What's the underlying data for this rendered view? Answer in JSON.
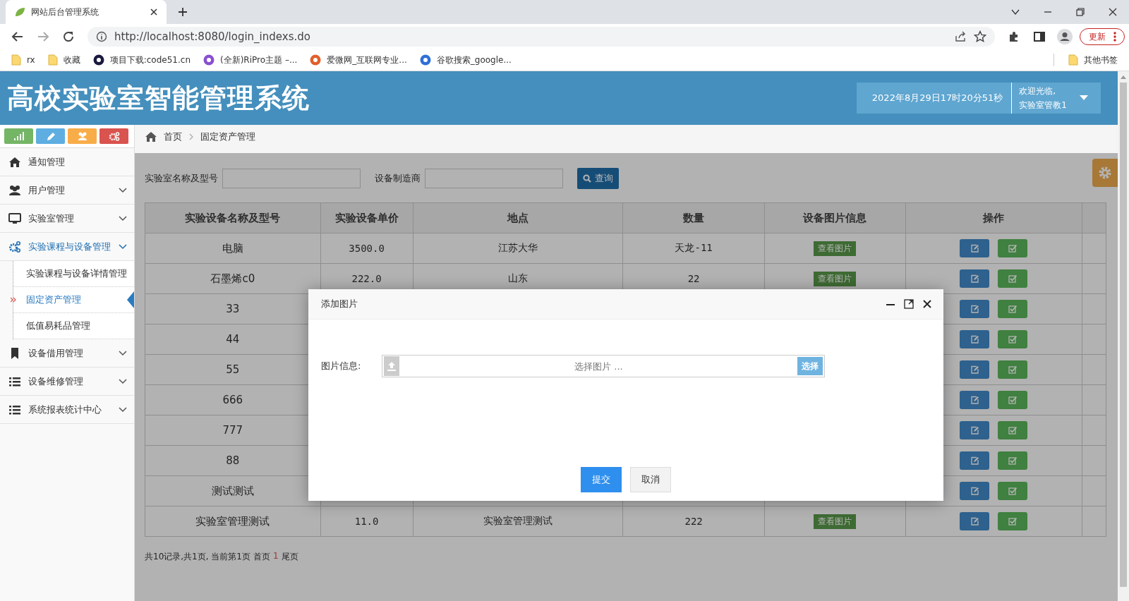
{
  "browser": {
    "tab_title": "网站后台管理系统",
    "url": "http://localhost:8080/login_indexs.do",
    "update_button": "更新",
    "other_bookmarks": "其他书签",
    "bookmarks": [
      {
        "label": "rx",
        "kind": "folder"
      },
      {
        "label": "收藏",
        "kind": "folder"
      },
      {
        "label": "项目下载:code51.cn",
        "kind": "site",
        "color": "#1a1a40"
      },
      {
        "label": "(全新)RiPro主题 –...",
        "kind": "site",
        "color": "#8a4fd0"
      },
      {
        "label": "爱微网_互联网专业...",
        "kind": "site",
        "color": "#e0602a"
      },
      {
        "label": "谷歌搜索_google...",
        "kind": "site",
        "color": "#2f6fd6"
      }
    ]
  },
  "header": {
    "title": "高校实验室智能管理系统",
    "datetime": "2022年8月29日17时20分51秒",
    "welcome": "欢迎光临,",
    "user": "实验室管教1"
  },
  "toolbar_buttons": [
    {
      "color": "#74b566"
    },
    {
      "color": "#5eaee1"
    },
    {
      "color": "#f8ad49"
    },
    {
      "color": "#d9534f"
    }
  ],
  "sidebar": {
    "items": [
      {
        "label": "通知管理",
        "kind": "link"
      },
      {
        "label": "用户管理",
        "kind": "group",
        "expanded": false
      },
      {
        "label": "实验室管理",
        "kind": "group",
        "expanded": false
      },
      {
        "label": "实验课程与设备管理",
        "kind": "group",
        "expanded": true,
        "children": [
          {
            "label": "实验课程与设备详情管理",
            "selected": false
          },
          {
            "label": "固定资产管理",
            "selected": true
          },
          {
            "label": "低值易耗品管理",
            "selected": false
          }
        ]
      },
      {
        "label": "设备借用管理",
        "kind": "group",
        "expanded": false
      },
      {
        "label": "设备维修管理",
        "kind": "group",
        "expanded": false
      },
      {
        "label": "系统报表统计中心",
        "kind": "group",
        "expanded": false
      }
    ]
  },
  "breadcrumb": [
    "首页",
    "固定资产管理"
  ],
  "search": {
    "fields": [
      {
        "label": "实验室名称及型号"
      },
      {
        "label": "设备制造商"
      }
    ],
    "button": "查询"
  },
  "table": {
    "columns": [
      "实验设备名称及型号",
      "实验设备单价",
      "地点",
      "数量",
      "设备图片信息",
      "操作"
    ],
    "rows": [
      {
        "name": "电脑",
        "price": "3500.0",
        "location": "江苏大华",
        "quantity": "天龙-11",
        "image_button": "查看图片"
      },
      {
        "name": "石墨烯c0",
        "price": "222.0",
        "location": "山东",
        "quantity": "22",
        "image_button": "查看图片"
      },
      {
        "name": "33"
      },
      {
        "name": "44"
      },
      {
        "name": "55"
      },
      {
        "name": "666"
      },
      {
        "name": "777"
      },
      {
        "name": "88"
      },
      {
        "name": "测试测试"
      },
      {
        "name": "实验室管理测试",
        "price": "11.0",
        "location": "实验室管理测试",
        "quantity": "222",
        "image_button": "查看图片"
      }
    ]
  },
  "pager": {
    "summary": "共10记录,共1页, 当前第1页",
    "first": "首页",
    "current": "1",
    "last": "尾页"
  },
  "modal": {
    "title": "添加图片",
    "field_label": "图片信息:",
    "placeholder": "选择图片 ...",
    "browse_button": "选择",
    "submit_button": "提交",
    "cancel_button": "取消"
  }
}
